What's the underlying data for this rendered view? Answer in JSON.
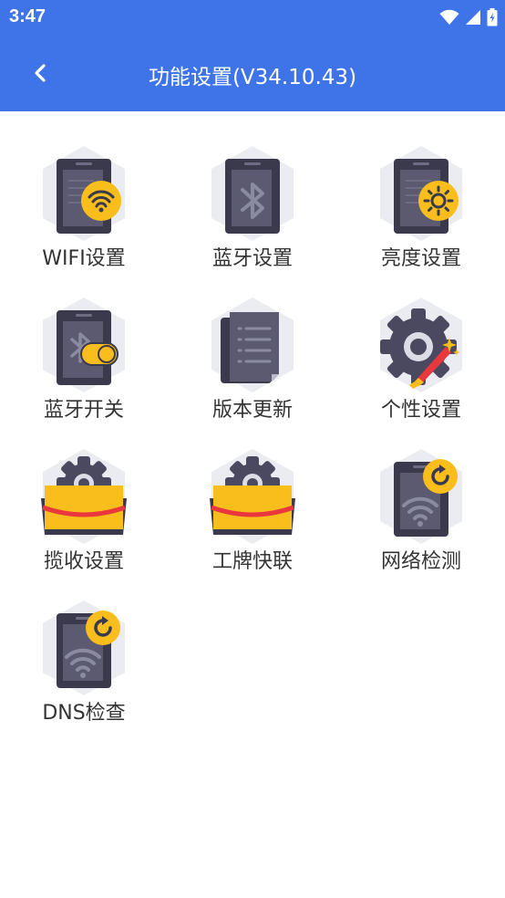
{
  "status_bar": {
    "time": "3:47"
  },
  "app_bar": {
    "title": "功能设置(V34.10.43)"
  },
  "functions": [
    {
      "label": "WIFI设置",
      "icon": "wifi-settings-icon"
    },
    {
      "label": "蓝牙设置",
      "icon": "bluetooth-settings-icon"
    },
    {
      "label": "亮度设置",
      "icon": "brightness-settings-icon"
    },
    {
      "label": "蓝牙开关",
      "icon": "bluetooth-toggle-icon"
    },
    {
      "label": "版本更新",
      "icon": "version-update-icon"
    },
    {
      "label": "个性设置",
      "icon": "personalization-icon"
    },
    {
      "label": "揽收设置",
      "icon": "pickup-settings-icon"
    },
    {
      "label": "工牌快联",
      "icon": "badge-quick-connect-icon"
    },
    {
      "label": "网络检测",
      "icon": "network-check-icon"
    },
    {
      "label": "DNS检查",
      "icon": "dns-check-icon"
    }
  ],
  "colors": {
    "primary": "#3e74e8",
    "hexagon_bg": "#ebebf2",
    "device_dark": "#3b3a4d",
    "device_mid": "#5b5a70",
    "accent_yellow": "#f9bd1c",
    "accent_red": "#e8383d"
  }
}
